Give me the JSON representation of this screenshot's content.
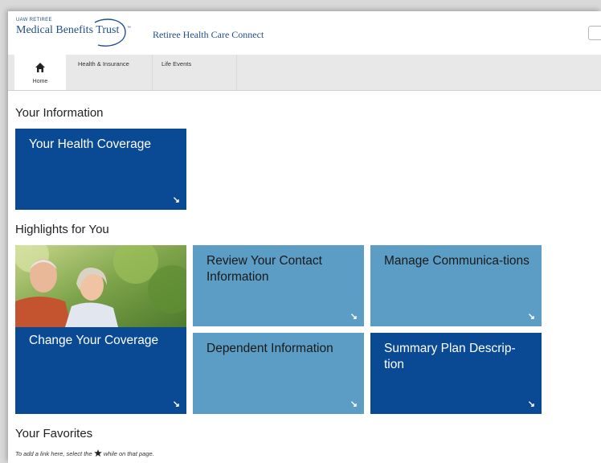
{
  "header": {
    "logo_small": "UAW RETIREE",
    "logo_main": "Medical Benefits Trust",
    "logo_tm": "™",
    "site_title": "Retiree Health Care Connect"
  },
  "nav": {
    "home_label": "Home",
    "items": [
      {
        "label": "Health & Insurance"
      },
      {
        "label": "Life Events"
      }
    ]
  },
  "your_information": {
    "heading": "Your Information",
    "tiles": [
      {
        "title": "Your Health Coverage"
      }
    ]
  },
  "highlights": {
    "heading": "Highlights for You",
    "tiles": [
      {
        "title": "Change Your Coverage"
      },
      {
        "title": "Review Your Contact Information"
      },
      {
        "title": "Manage Communica-tions"
      },
      {
        "title": "Dependent Information"
      },
      {
        "title": "Summary Plan Descrip-tion"
      }
    ]
  },
  "favorites": {
    "heading": "Your Favorites",
    "note_before": "To add a link here, select the",
    "note_after": "while on that page."
  },
  "arrow_glyph": "↘",
  "colors": {
    "tile_dark": "#0a4a94",
    "tile_light": "#5b9dc4",
    "brand_text": "#1f4e8c",
    "nav_bg": "#e8e8e8"
  }
}
